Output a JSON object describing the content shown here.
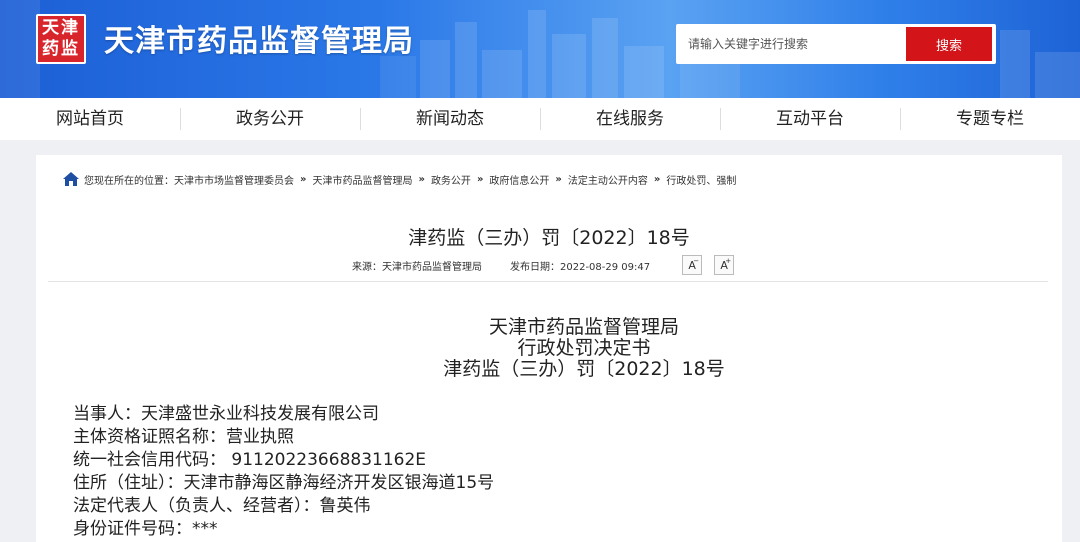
{
  "header": {
    "logo_text": "天津药监",
    "site_title": "天津市药品监督管理局",
    "search": {
      "placeholder": "请输入关键字进行搜索",
      "button_label": "搜索"
    },
    "colors": {
      "accent_red": "#d3151a",
      "banner_blue": "#2a78e8"
    }
  },
  "nav": {
    "items": [
      {
        "label": "网站首页"
      },
      {
        "label": "政务公开"
      },
      {
        "label": "新闻动态"
      },
      {
        "label": "在线服务"
      },
      {
        "label": "互动平台"
      },
      {
        "label": "专题专栏"
      }
    ]
  },
  "breadcrumb": {
    "prefix": "您现在所在的位置：",
    "items": [
      {
        "label": "天津市市场监督管理委员会"
      },
      {
        "label": "天津市药品监督管理局"
      },
      {
        "label": "政务公开"
      },
      {
        "label": "政府信息公开"
      },
      {
        "label": "法定主动公开内容"
      },
      {
        "label": "行政处罚、强制"
      }
    ],
    "separator": "»"
  },
  "article": {
    "title": "津药监（三办）罚〔2022〕18号",
    "source": "来源：天津市药品监督管理局",
    "date": "发布日期：2022-08-29 09:47",
    "font_decrease": "A",
    "font_increase": "A",
    "heading_lines": [
      "天津市药品监督管理局",
      "行政处罚决定书",
      "津药监（三办）罚〔2022〕18号"
    ],
    "body_lines": [
      "当事人：天津盛世永业科技发展有限公司",
      "主体资格证照名称：营业执照",
      "统一社会信用代码： 91120223668831162E",
      "住所（住址）：天津市静海区静海经济开发区银海道15号",
      "法定代表人（负责人、经营者）：鲁英伟",
      "身份证件号码：***"
    ]
  }
}
